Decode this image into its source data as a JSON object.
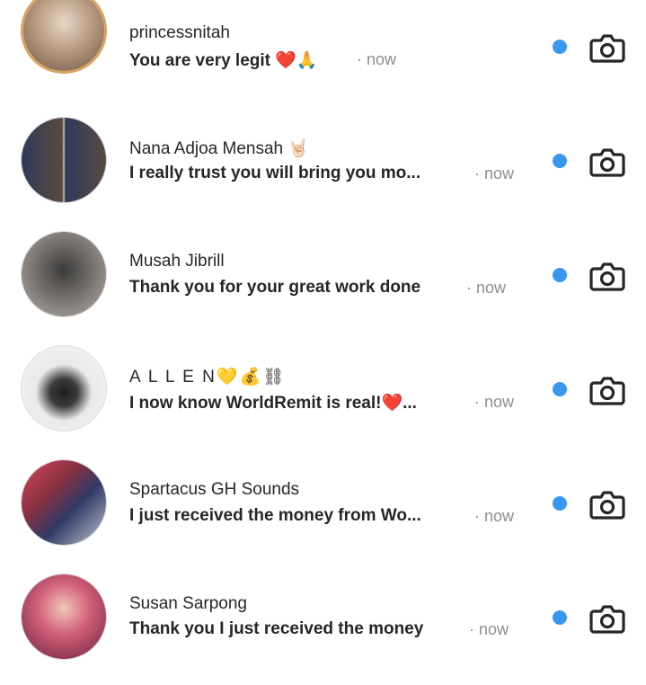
{
  "threads": [
    {
      "name": "princessnitah",
      "message": "You are very legit ❤️🙏",
      "time": "· now"
    },
    {
      "name": "Nana Adjoa Mensah 🤘🏻",
      "message": "I really trust you will bring you mo...",
      "time": "· now"
    },
    {
      "name": "Musah Jibrill",
      "message": "Thank you for your great work done",
      "time": "· now"
    },
    {
      "name": "A L L E N💛💰⛓",
      "message": "I now know WorldRemit is real!❤️...",
      "time": "· now"
    },
    {
      "name": "Spartacus GH Sounds",
      "message": "I just received the money from Wo...",
      "time": "· now"
    },
    {
      "name": "Susan Sarpong",
      "message": "Thank you I just received the money",
      "time": "· now"
    }
  ],
  "colors": {
    "unread_dot": "#3897f0",
    "story_ring": "#d9a35b",
    "secondary_text": "#8e8e8e"
  },
  "icons": {
    "camera": "camera-icon"
  }
}
